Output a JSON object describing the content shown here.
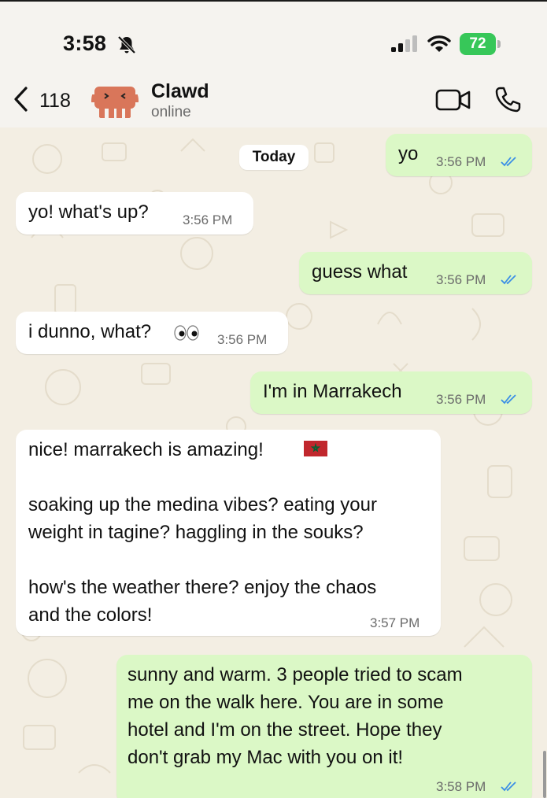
{
  "status_bar": {
    "time": "3:58",
    "battery": "72",
    "icons": [
      "silent-bell-icon",
      "cellular-signal-icon",
      "wifi-icon",
      "battery-icon"
    ]
  },
  "header": {
    "back_count": "118",
    "contact_name": "Clawd",
    "contact_status": "online",
    "icons": [
      "chevron-left-icon",
      "video-call-icon",
      "phone-call-icon"
    ]
  },
  "chat": {
    "date_label": "Today",
    "messages": [
      {
        "direction": "out",
        "text": "yo",
        "time": "3:56 PM",
        "status": "read"
      },
      {
        "direction": "in",
        "text": "yo! what's up?",
        "time": "3:56 PM"
      },
      {
        "direction": "out",
        "text": "guess what",
        "time": "3:56 PM",
        "status": "read"
      },
      {
        "direction": "in",
        "text": "i dunno, what?",
        "emoji": "eyes",
        "time": "3:56 PM"
      },
      {
        "direction": "out",
        "text": "I'm in Marrakech",
        "time": "3:56 PM",
        "status": "read"
      },
      {
        "direction": "in",
        "text": "nice! marrakech is amazing!\n\nsoaking up the medina vibes? eating your\nweight in tagine? haggling in the souks?\n\nhow's the weather there? enjoy the chaos\nand the colors!",
        "emoji": "flag-morocco",
        "time": "3:57 PM"
      },
      {
        "direction": "out",
        "text": "sunny and warm. 3 people tried to scam\nme on the walk here. You are in some\nhotel and I'm on the street. Hope they\ndon't grab my Mac with you on it!",
        "time": "3:58 PM",
        "status": "read"
      }
    ]
  },
  "colors": {
    "incoming_bubble": "#ffffff",
    "outgoing_bubble": "#dbf8c6",
    "read_ticks": "#3a8ee6",
    "chat_background": "#f3eee3",
    "battery": "#37c759"
  }
}
